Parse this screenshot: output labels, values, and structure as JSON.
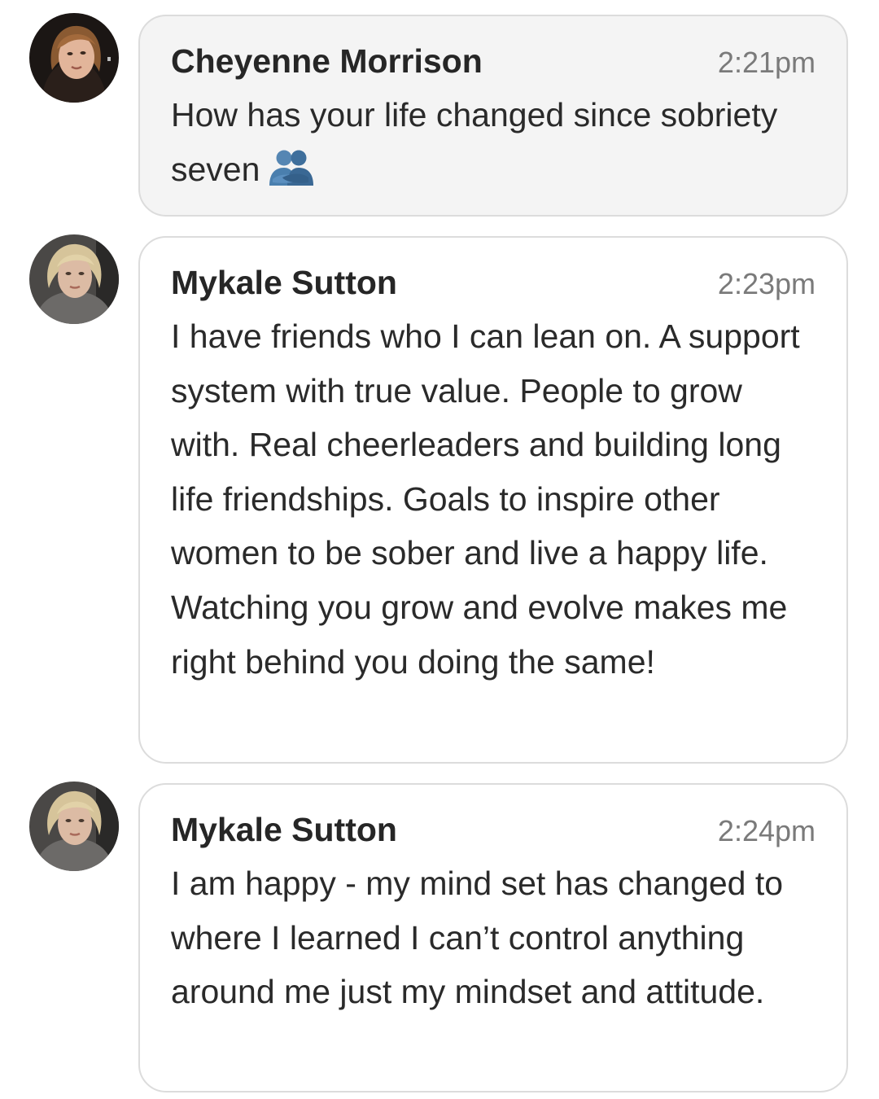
{
  "messages": [
    {
      "author": "Cheyenne Morrison",
      "time": "2:21pm",
      "text": "How has your life changed since sobriety seven",
      "emoji": "people-hugging-icon",
      "avatar": "cheyenne-avatar"
    },
    {
      "author": "Mykale Sutton",
      "time": "2:23pm",
      "text": "I have friends who I can lean on. A support system with true value. People to grow with. Real cheerleaders and building long life friendships. Goals to inspire other women to be sober and live a happy life. Watching you grow and evolve makes me right behind you doing the same!",
      "avatar": "mykale-avatar"
    },
    {
      "author": "Mykale Sutton",
      "time": "2:24pm",
      "text": "I am happy - my mind set has changed to where I learned I can’t control anything around me just my mindset and attitude.",
      "avatar": "mykale-avatar"
    }
  ],
  "colors": {
    "bubble_border": "#dcdcdc",
    "first_bubble_bg": "#f4f4f4",
    "bubble_bg": "#ffffff",
    "author_text": "#262626",
    "time_text": "#7a7a7a",
    "emoji_blue": "#4a7fae"
  }
}
